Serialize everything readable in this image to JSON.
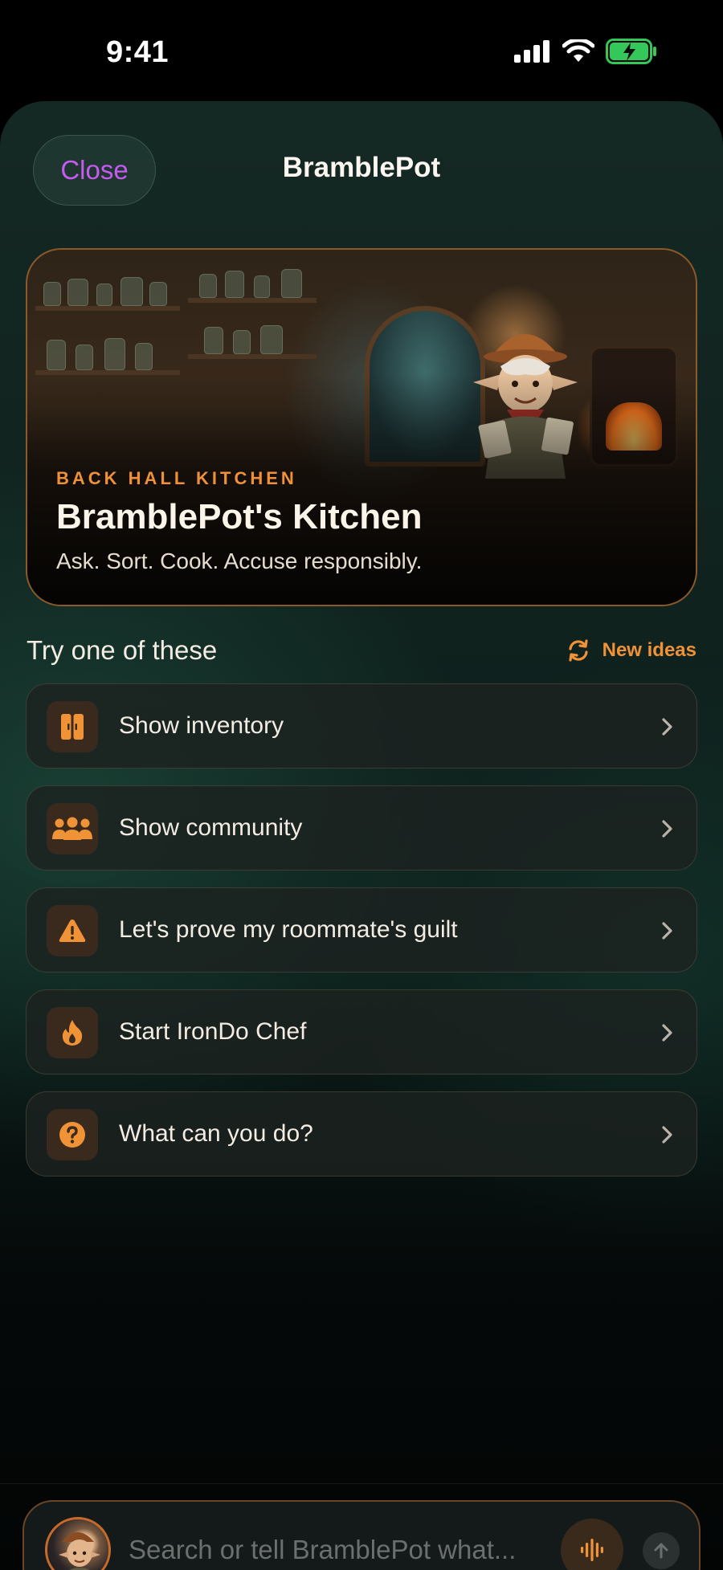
{
  "status": {
    "time": "9:41"
  },
  "header": {
    "close_label": "Close",
    "title": "BramblePot"
  },
  "hero": {
    "kicker": "BACK HALL KITCHEN",
    "title": "BramblePot's Kitchen",
    "subtitle": "Ask. Sort. Cook. Accuse responsibly."
  },
  "suggestions": {
    "title": "Try one of these",
    "refresh_label": "New ideas",
    "items": [
      {
        "label": "Show inventory",
        "icon": "cabinet-icon"
      },
      {
        "label": "Show community",
        "icon": "people-icon"
      },
      {
        "label": "Let's prove my roommate's guilt",
        "icon": "warning-icon"
      },
      {
        "label": "Start IronDo Chef",
        "icon": "flame-icon"
      },
      {
        "label": "What can you do?",
        "icon": "question-icon"
      }
    ]
  },
  "composer": {
    "placeholder": "Search or tell BramblePot what...",
    "value": ""
  },
  "colors": {
    "accent": "#f09236",
    "close": "#c55bf0",
    "battery": "#34c759"
  }
}
